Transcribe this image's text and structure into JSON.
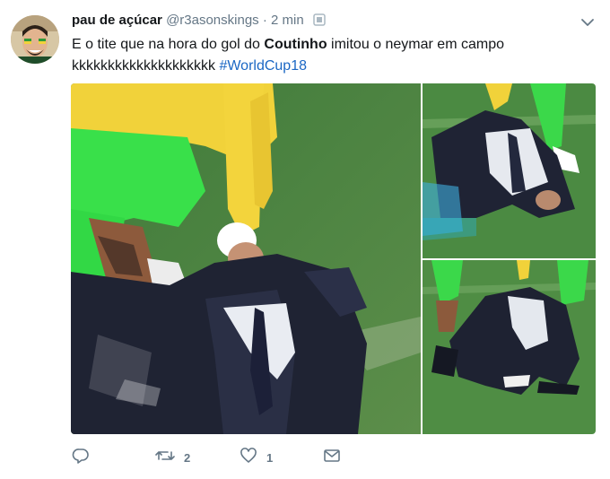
{
  "tweet": {
    "display_name": "pau de açúcar",
    "handle": "@r3asonskings",
    "separator": "·",
    "time": "2 min",
    "text_part1": "E o tite que na hora do gol do ",
    "text_bold": "Coutinho",
    "text_part2": " imitou o neymar em campo",
    "text_line2": "kkkkkkkkkkkkkkkkkkkk ",
    "hashtag": "#WorldCup18"
  },
  "actions": {
    "retweet_count": "2",
    "like_count": "1"
  },
  "colors": {
    "text": "#14171a",
    "secondary": "#657786",
    "link": "#1b67c4"
  },
  "icons": [
    "chevron-down-icon",
    "reply-icon",
    "retweet-icon",
    "heart-icon",
    "envelope-icon",
    "verified-icon"
  ]
}
